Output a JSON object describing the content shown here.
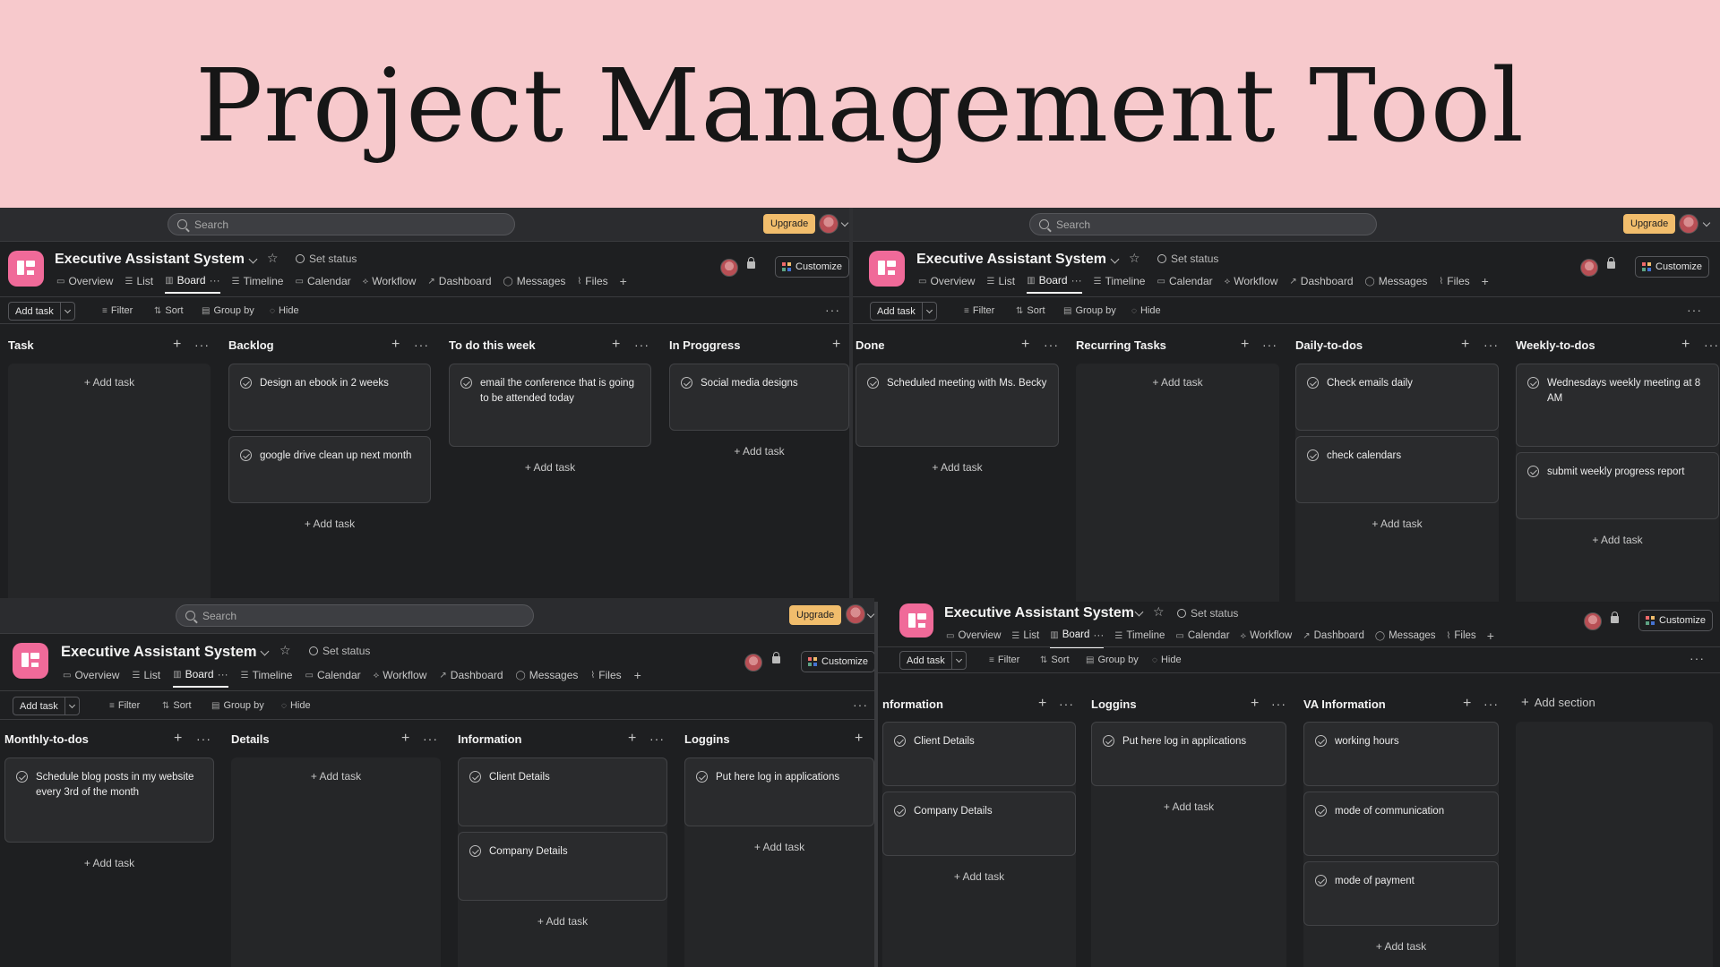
{
  "banner": {
    "title": "Project Management Tool"
  },
  "common": {
    "search_placeholder": "Search",
    "upgrade_label": "Upgrade",
    "project_title": "Executive Assistant System",
    "set_status": "Set status",
    "customize": "Customize",
    "tabs": [
      {
        "label": "Overview",
        "icon": "overview-icon"
      },
      {
        "label": "List",
        "icon": "list-icon"
      },
      {
        "label": "Board",
        "icon": "board-icon",
        "active": true
      },
      {
        "label": "Timeline",
        "icon": "timeline-icon"
      },
      {
        "label": "Calendar",
        "icon": "calendar-icon"
      },
      {
        "label": "Workflow",
        "icon": "workflow-icon"
      },
      {
        "label": "Dashboard",
        "icon": "dashboard-icon"
      },
      {
        "label": "Messages",
        "icon": "messages-icon"
      },
      {
        "label": "Files",
        "icon": "files-icon"
      }
    ],
    "toolbar": {
      "add_task": "Add task",
      "filter": "Filter",
      "sort": "Sort",
      "group_by": "Group by",
      "hide": "Hide"
    },
    "add_task_text": "+ Add task"
  },
  "panels": {
    "tl": {
      "columns": [
        {
          "title": "Task",
          "cards": []
        },
        {
          "title": "Backlog",
          "cards": [
            "Design an ebook in 2 weeks",
            "google drive clean up next month"
          ]
        },
        {
          "title": "To do this week",
          "cards": [
            "email the conference that is going to be attended today"
          ]
        },
        {
          "title": "In Proggress",
          "cards": [
            "Social media designs"
          ]
        }
      ]
    },
    "tr": {
      "columns": [
        {
          "title": "Done",
          "cards": [
            "Scheduled meeting with Ms. Becky"
          ]
        },
        {
          "title": "Recurring Tasks",
          "cards": []
        },
        {
          "title": "Daily-to-dos",
          "cards": [
            "Check emails daily",
            "check calendars"
          ]
        },
        {
          "title": "Weekly-to-dos",
          "cards": [
            "Wednesdays weekly meeting at 8 AM",
            "submit weekly progress report"
          ]
        }
      ]
    },
    "bl": {
      "columns": [
        {
          "title": "Monthly-to-dos",
          "cards": [
            "Schedule blog posts in my website every 3rd of the month"
          ]
        },
        {
          "title": "Details",
          "cards": []
        },
        {
          "title": "Information",
          "cards": [
            "Client Details",
            "Company Details"
          ]
        },
        {
          "title": "Loggins",
          "cards": [
            "Put here log in applications"
          ]
        }
      ]
    },
    "br": {
      "columns": [
        {
          "title": "nformation",
          "cards": [
            "Client Details",
            "Company Details"
          ]
        },
        {
          "title": "Loggins",
          "cards": [
            "Put here log in applications"
          ]
        },
        {
          "title": "VA Information",
          "cards": [
            "working hours",
            "mode of communication",
            "mode of payment"
          ]
        }
      ],
      "add_section": "Add section"
    }
  }
}
